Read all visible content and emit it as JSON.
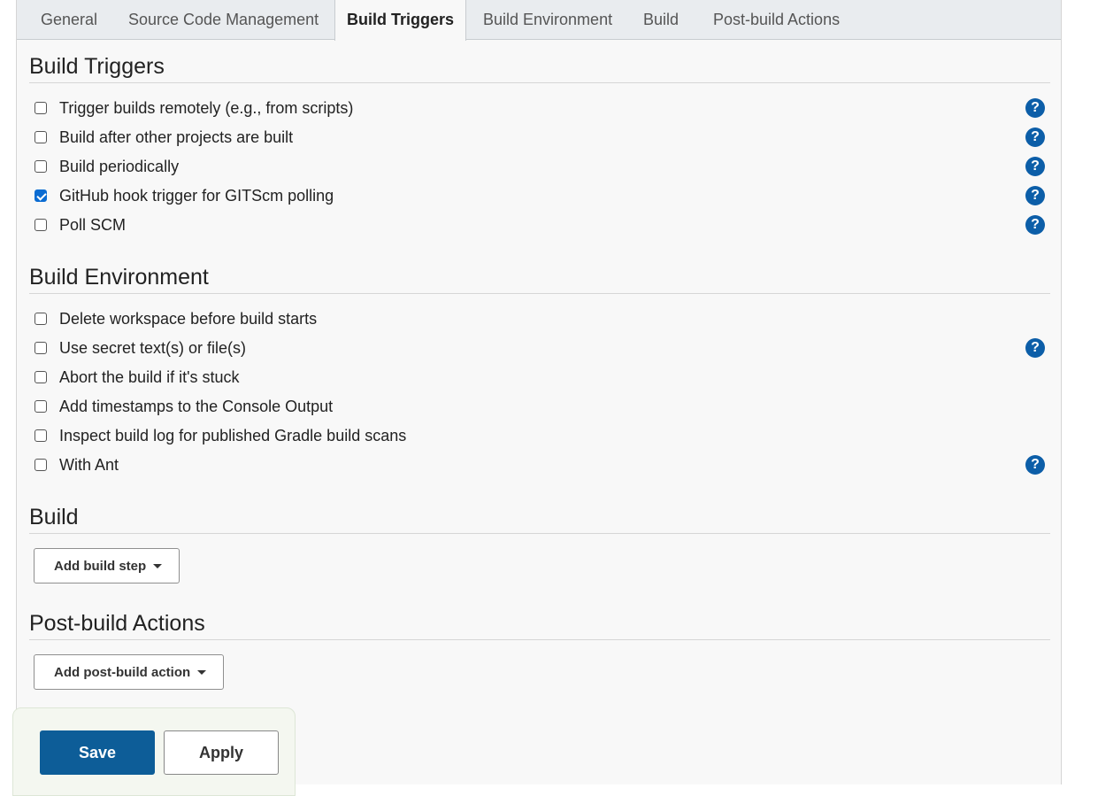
{
  "tabs": [
    {
      "label": "General"
    },
    {
      "label": "Source Code Management"
    },
    {
      "label": "Build Triggers",
      "active": true
    },
    {
      "label": "Build Environment"
    },
    {
      "label": "Build"
    },
    {
      "label": "Post-build Actions"
    }
  ],
  "build_triggers": {
    "title": "Build Triggers",
    "items": [
      {
        "label": "Trigger builds remotely (e.g., from scripts)",
        "checked": false,
        "help": true
      },
      {
        "label": "Build after other projects are built",
        "checked": false,
        "help": true
      },
      {
        "label": "Build periodically",
        "checked": false,
        "help": true
      },
      {
        "label": "GitHub hook trigger for GITScm polling",
        "checked": true,
        "help": true
      },
      {
        "label": "Poll SCM",
        "checked": false,
        "help": true
      }
    ]
  },
  "build_environment": {
    "title": "Build Environment",
    "items": [
      {
        "label": "Delete workspace before build starts",
        "checked": false,
        "help": false
      },
      {
        "label": "Use secret text(s) or file(s)",
        "checked": false,
        "help": true
      },
      {
        "label": "Abort the build if it's stuck",
        "checked": false,
        "help": false
      },
      {
        "label": "Add timestamps to the Console Output",
        "checked": false,
        "help": false
      },
      {
        "label": "Inspect build log for published Gradle build scans",
        "checked": false,
        "help": false
      },
      {
        "label": "With Ant",
        "checked": false,
        "help": true
      }
    ]
  },
  "build": {
    "title": "Build",
    "add_label": "Add build step"
  },
  "post_build": {
    "title": "Post-build Actions",
    "add_label": "Add post-build action"
  },
  "footer": {
    "save_label": "Save",
    "apply_label": "Apply"
  },
  "help_glyph": "?",
  "colors": {
    "primary": "#0d5d98",
    "checkbox_checked": "#0b6cd2",
    "help_icon": "#0c5ea8"
  }
}
